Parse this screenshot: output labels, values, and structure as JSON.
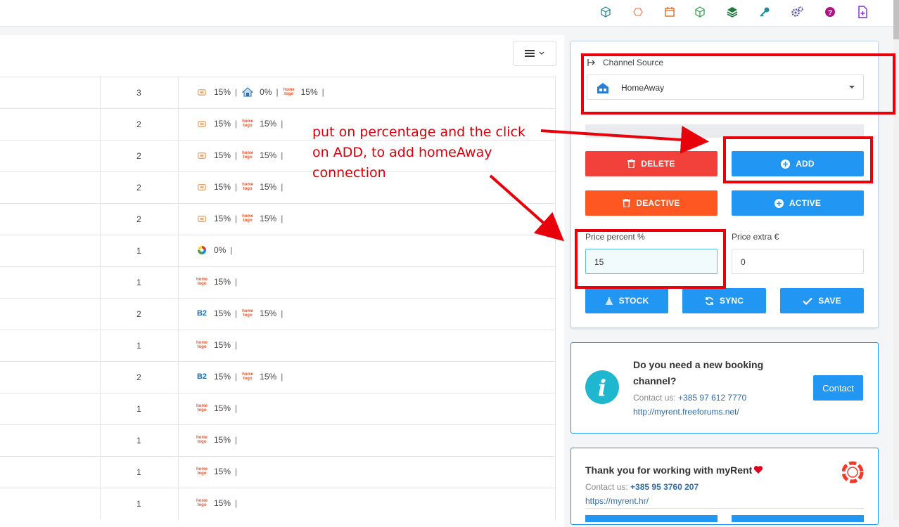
{
  "toolbar": {
    "icons": [
      "cube-outline-icon",
      "house-outline-icon",
      "calendar-icon",
      "cube-outline-green-icon",
      "layers-icon",
      "key-icon",
      "settings-gears-icon",
      "help-icon",
      "new-document-icon"
    ]
  },
  "table": {
    "rows": [
      {
        "count": "3",
        "channels": [
          {
            "logo": "orange-tag",
            "pct": "15%"
          },
          {
            "logo": "house-blue",
            "pct": "0%"
          },
          {
            "logo": "hometogo",
            "pct": "15%"
          }
        ]
      },
      {
        "count": "2",
        "channels": [
          {
            "logo": "orange-tag",
            "pct": "15%"
          },
          {
            "logo": "hometogo",
            "pct": "15%"
          }
        ]
      },
      {
        "count": "2",
        "channels": [
          {
            "logo": "orange-tag",
            "pct": "15%"
          },
          {
            "logo": "hometogo",
            "pct": "15%"
          }
        ]
      },
      {
        "count": "2",
        "channels": [
          {
            "logo": "orange-tag",
            "pct": "15%"
          },
          {
            "logo": "hometogo",
            "pct": "15%"
          }
        ]
      },
      {
        "count": "2",
        "channels": [
          {
            "logo": "orange-tag",
            "pct": "15%"
          },
          {
            "logo": "hometogo",
            "pct": "15%"
          }
        ]
      },
      {
        "count": "1",
        "channels": [
          {
            "logo": "vrbo-circle",
            "pct": "0%"
          }
        ]
      },
      {
        "count": "1",
        "channels": [
          {
            "logo": "hometogo",
            "pct": "15%"
          }
        ]
      },
      {
        "count": "2",
        "channels": [
          {
            "logo": "b2",
            "pct": "15%"
          },
          {
            "logo": "hometogo",
            "pct": "15%"
          }
        ]
      },
      {
        "count": "1",
        "channels": [
          {
            "logo": "hometogo",
            "pct": "15%"
          }
        ]
      },
      {
        "count": "2",
        "channels": [
          {
            "logo": "b2",
            "pct": "15%"
          },
          {
            "logo": "hometogo",
            "pct": "15%"
          }
        ]
      },
      {
        "count": "1",
        "channels": [
          {
            "logo": "hometogo",
            "pct": "15%"
          }
        ]
      },
      {
        "count": "1",
        "channels": [
          {
            "logo": "hometogo",
            "pct": "15%"
          }
        ]
      },
      {
        "count": "1",
        "channels": [
          {
            "logo": "hometogo",
            "pct": "15%"
          }
        ]
      },
      {
        "count": "1",
        "channels": [
          {
            "logo": "hometogo",
            "pct": "15%"
          }
        ]
      }
    ],
    "logo_texts": {
      "hometogo": "home\ntogo",
      "b2": "B2"
    }
  },
  "panel": {
    "channel_source_label": "Channel Source",
    "selected_channel": "HomeAway",
    "buttons": {
      "delete": "DELETE",
      "add": "ADD",
      "deactive": "DEACTIVE",
      "active": "ACTIVE",
      "stock": "STOCK",
      "sync": "SYNC",
      "save": "SAVE"
    },
    "price_percent_label": "Price percent %",
    "price_percent_value": "15",
    "price_extra_label": "Price extra €",
    "price_extra_value": "0"
  },
  "info_box": {
    "title_line1": "Do you need a new booking",
    "title_line2": "channel?",
    "contact_prefix": "Contact us: ",
    "contact_phone": "+385 97 612 7770",
    "forum_link": "http://myrent.freeforums.net/",
    "contact_button": "Contact"
  },
  "thanks_box": {
    "title": "Thank you for working with myRent",
    "contact_prefix": "Contact us: ",
    "contact_phone": "+385 95 3760 207",
    "site_link": "https://myrent.hr/"
  },
  "annotation": {
    "line1": "put on percentage and the click",
    "line2": "on ADD, to add homeAway",
    "line3": "connection"
  },
  "colors": {
    "red_button": "#f2413a",
    "orange_button": "#ff5722",
    "blue_button": "#2196f3",
    "annotation_red": "#e8000b"
  }
}
